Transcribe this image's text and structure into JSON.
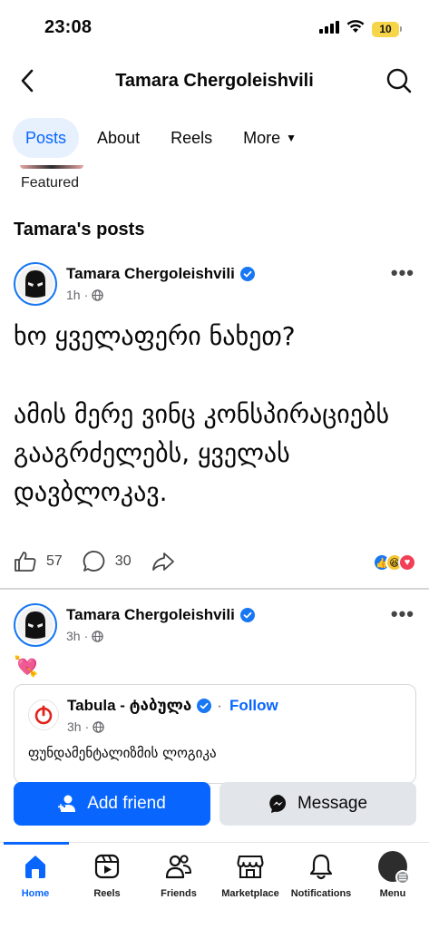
{
  "status_bar": {
    "time": "23:08",
    "battery_level": "10"
  },
  "header": {
    "title": "Tamara Chergoleishvili"
  },
  "tabs": [
    {
      "label": "Posts",
      "active": true
    },
    {
      "label": "About",
      "active": false
    },
    {
      "label": "Reels",
      "active": false
    },
    {
      "label": "More",
      "active": false
    }
  ],
  "featured": {
    "label": "Featured"
  },
  "posts_heading": "Tamara's posts",
  "post1": {
    "author": "Tamara Chergoleishvili",
    "time": "1h",
    "text": "ხო ყველაფერი ნახეთ?\n\nამის მერე ვინც კონსპირაციებს გააგრძელებს, ყველას დავბლოკავ.",
    "likes": "57",
    "comments": "30"
  },
  "post2": {
    "author": "Tamara Chergoleishvili",
    "time": "3h",
    "emoji": "💘",
    "shared": {
      "author": "Tabula - ტაბულა",
      "follow": "Follow",
      "time": "3h",
      "text": "ფუნდამენტალიზმის ლოგიკა"
    }
  },
  "buttons": {
    "add_friend": "Add friend",
    "message": "Message"
  },
  "bottom_nav": [
    {
      "label": "Home"
    },
    {
      "label": "Reels"
    },
    {
      "label": "Friends"
    },
    {
      "label": "Marketplace"
    },
    {
      "label": "Notifications"
    },
    {
      "label": "Menu"
    }
  ],
  "colors": {
    "accent": "#0866ff",
    "verified": "#1877f2",
    "muted": "#65676b"
  }
}
